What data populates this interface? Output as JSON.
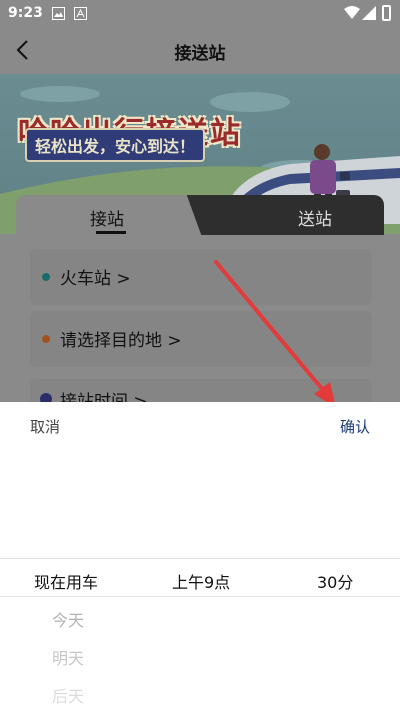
{
  "status_bar": {
    "time": "9:23"
  },
  "header": {
    "title": "接送站"
  },
  "banner": {
    "headline": "哈哈出行接送站",
    "slogan": "轻松出发，安心到达！"
  },
  "tabs": [
    {
      "label": "接站"
    },
    {
      "label": "送站"
    }
  ],
  "form": {
    "station": "火车站 >",
    "destination": "请选择目的地 >",
    "time_partial": "接站时间 >"
  },
  "colors": {
    "station_dot": "#1a6b6b",
    "destination_dot": "#a2521e",
    "time_dot": "#2a2d6a",
    "arrow": "#e23b3b",
    "confirm": "#1d3b7a"
  },
  "picker": {
    "cancel": "取消",
    "confirm": "确认",
    "selected_day": "现在用车",
    "selected_hour": "上午9点",
    "selected_minute": "30分",
    "day_options": [
      "今天",
      "明天",
      "后天"
    ]
  }
}
